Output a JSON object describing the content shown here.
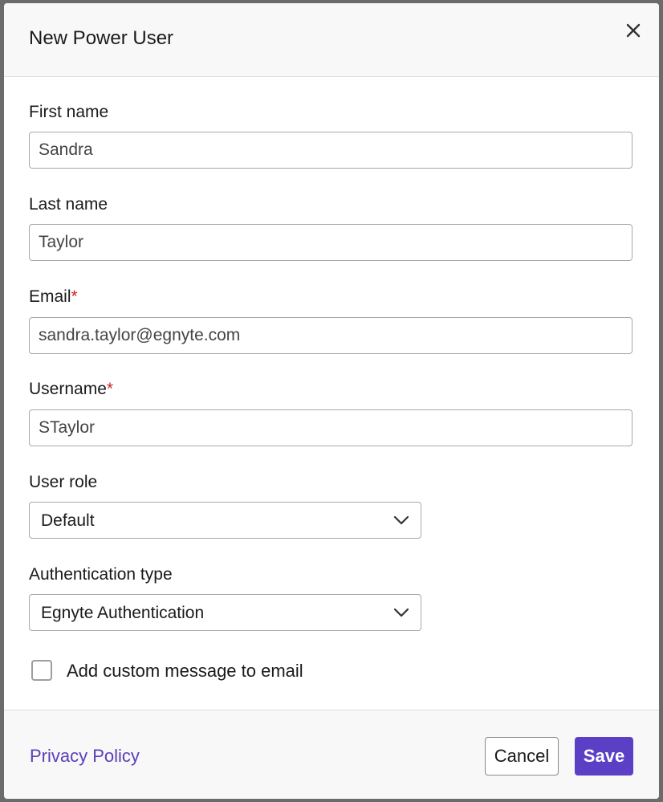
{
  "modal": {
    "title": "New Power User",
    "close_icon": "close-icon"
  },
  "fields": {
    "first_name": {
      "label": "First name",
      "value": "Sandra"
    },
    "last_name": {
      "label": "Last name",
      "value": "Taylor"
    },
    "email": {
      "label": "Email",
      "required_mark": "*",
      "value": "sandra.taylor@egnyte.com"
    },
    "username": {
      "label": "Username",
      "required_mark": "*",
      "value": "STaylor"
    },
    "user_role": {
      "label": "User role",
      "selected": "Default"
    },
    "auth_type": {
      "label": "Authentication type",
      "selected": "Egnyte Authentication"
    }
  },
  "custom_message": {
    "label": "Add custom message to email",
    "checked": false
  },
  "footer": {
    "privacy_link": "Privacy Policy",
    "cancel_label": "Cancel",
    "save_label": "Save"
  },
  "colors": {
    "accent": "#5b3fc4",
    "link": "#5b3fb8",
    "required": "#c62828"
  }
}
